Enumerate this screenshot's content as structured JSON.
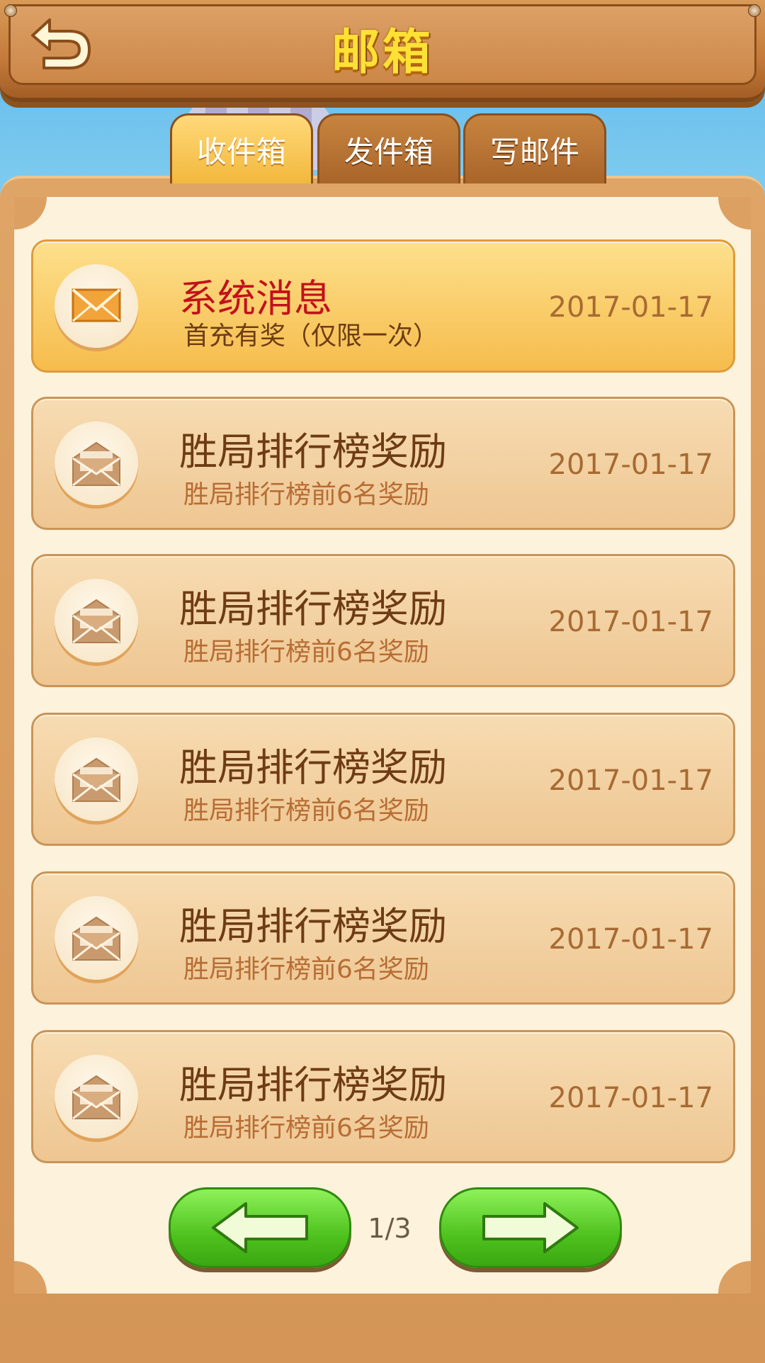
{
  "header": {
    "title": "邮箱",
    "back_icon": "back-arrow-icon"
  },
  "tabs": [
    {
      "label": "收件箱",
      "active": true
    },
    {
      "label": "发件箱",
      "active": false
    },
    {
      "label": "写邮件",
      "active": false
    }
  ],
  "mails": [
    {
      "title": "系统消息",
      "subtitle": "首充有奖（仅限一次）",
      "date": "2017-01-17",
      "read": false,
      "icon": "envelope-closed-icon"
    },
    {
      "title": "胜局排行榜奖励",
      "subtitle": "胜局排行榜前6名奖励",
      "date": "2017-01-17",
      "read": true,
      "icon": "envelope-open-icon"
    },
    {
      "title": "胜局排行榜奖励",
      "subtitle": "胜局排行榜前6名奖励",
      "date": "2017-01-17",
      "read": true,
      "icon": "envelope-open-icon"
    },
    {
      "title": "胜局排行榜奖励",
      "subtitle": "胜局排行榜前6名奖励",
      "date": "2017-01-17",
      "read": true,
      "icon": "envelope-open-icon"
    },
    {
      "title": "胜局排行榜奖励",
      "subtitle": "胜局排行榜前6名奖励",
      "date": "2017-01-17",
      "read": true,
      "icon": "envelope-open-icon"
    },
    {
      "title": "胜局排行榜奖励",
      "subtitle": "胜局排行榜前6名奖励",
      "date": "2017-01-17",
      "read": true,
      "icon": "envelope-open-icon"
    }
  ],
  "pagination": {
    "indicator": "1/3",
    "prev_icon": "arrow-left-icon",
    "next_icon": "arrow-right-icon"
  },
  "colors": {
    "title_yellow": "#ffe135",
    "unread_title": "#c2111a",
    "button_green": "#4fc21e"
  }
}
